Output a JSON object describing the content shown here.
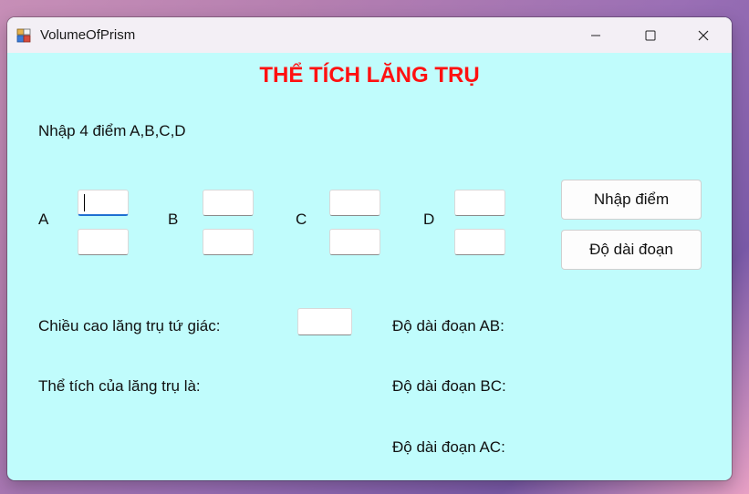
{
  "window": {
    "title": "VolumeOfPrism"
  },
  "heading": "THỂ TÍCH LĂNG TRỤ",
  "instruction": "Nhập 4 điểm A,B,C,D",
  "points": [
    {
      "label": "A",
      "x_value": "",
      "y_value": ""
    },
    {
      "label": "B",
      "x_value": "",
      "y_value": ""
    },
    {
      "label": "C",
      "x_value": "",
      "y_value": ""
    },
    {
      "label": "D",
      "x_value": "",
      "y_value": ""
    }
  ],
  "buttons": {
    "enter_points": "Nhập điểm",
    "segment_length": "Độ dài đoạn"
  },
  "height_label": "Chiều cao lăng trụ tứ giác:",
  "height_value": "",
  "volume_label": "Thể tích của lăng trụ là:",
  "segments": {
    "ab": "Độ dài đoạn AB:",
    "bc": "Độ dài đoạn BC:",
    "ac": "Độ dài đoạn AC:"
  }
}
